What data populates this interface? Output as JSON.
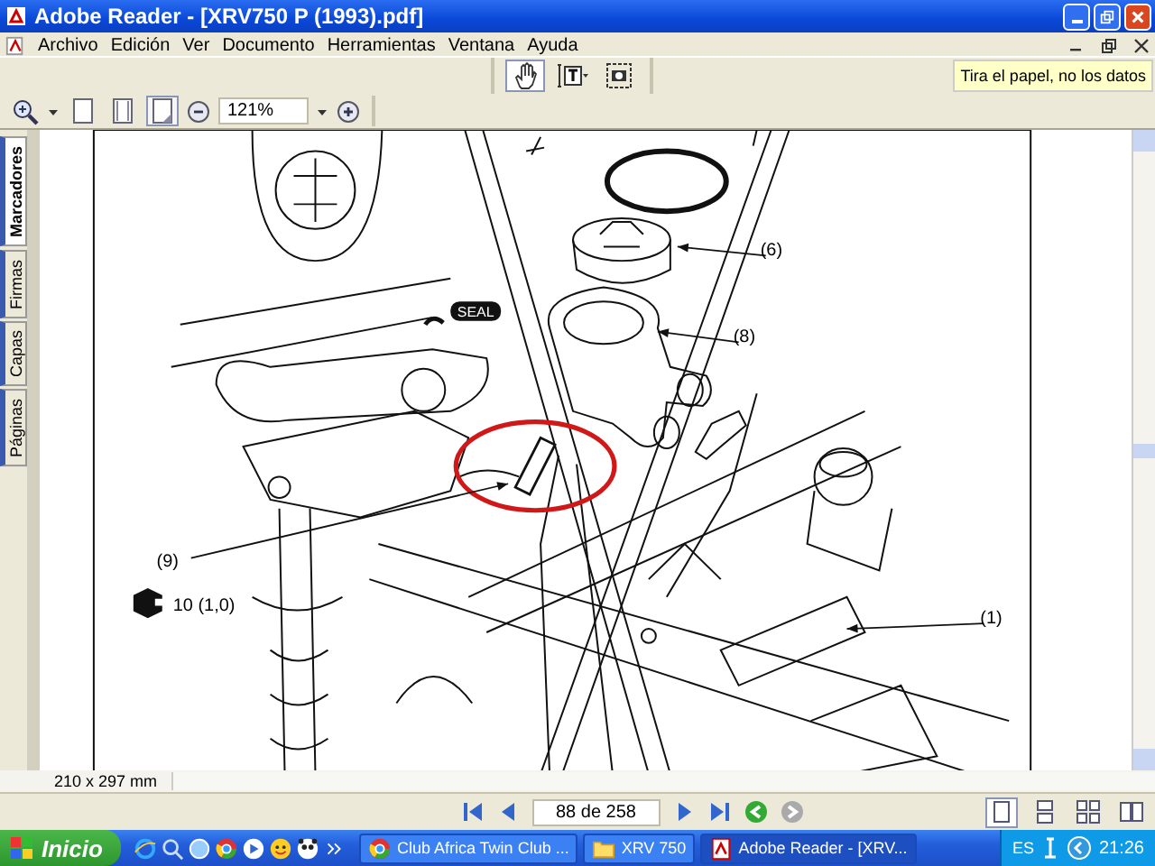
{
  "window": {
    "title": "Adobe Reader - [XRV750 P (1993).pdf]"
  },
  "menu": [
    "Archivo",
    "Edición",
    "Ver",
    "Documento",
    "Herramientas",
    "Ventana",
    "Ayuda"
  ],
  "tools": [
    {
      "kind": "hand",
      "selected": true
    },
    {
      "kind": "text-select",
      "selected": false
    },
    {
      "kind": "snapshot",
      "selected": false
    }
  ],
  "tooltip": "Tira el papel, no los datos",
  "page_views": [
    {
      "kind": "single",
      "selected": false
    },
    {
      "kind": "fit-width",
      "selected": false
    },
    {
      "kind": "fit-page",
      "selected": true
    }
  ],
  "zoom": {
    "value": "121%"
  },
  "nav_tabs": [
    {
      "label": "Marcadores",
      "selected": true
    },
    {
      "label": "Firmas",
      "selected": false
    },
    {
      "label": "Capas",
      "selected": false
    },
    {
      "label": "Páginas",
      "selected": false
    }
  ],
  "drawing": {
    "callouts": [
      {
        "label": "(6)"
      },
      {
        "label": "(8)"
      },
      {
        "label": "(9)"
      },
      {
        "label": "(1)"
      }
    ],
    "seal": "SEAL",
    "torque": "10 (1,0)"
  },
  "page_size": "210 x 297 mm",
  "page_nav": {
    "page": "88 de 258"
  },
  "layouts": [
    {
      "kind": "single",
      "selected": true
    },
    {
      "kind": "continuous",
      "selected": false
    },
    {
      "kind": "facing-continuous",
      "selected": false
    },
    {
      "kind": "facing",
      "selected": false
    }
  ],
  "taskbar": {
    "start": "Inicio",
    "tasks": [
      {
        "kind": "browser",
        "label": "Club Africa Twin Club ...",
        "selected": false
      },
      {
        "kind": "folder",
        "label": "XRV 750",
        "selected": false
      },
      {
        "kind": "pdf",
        "label": "Adobe Reader - [XRV...",
        "selected": true
      }
    ],
    "language": "ES",
    "clock": "21:26"
  }
}
